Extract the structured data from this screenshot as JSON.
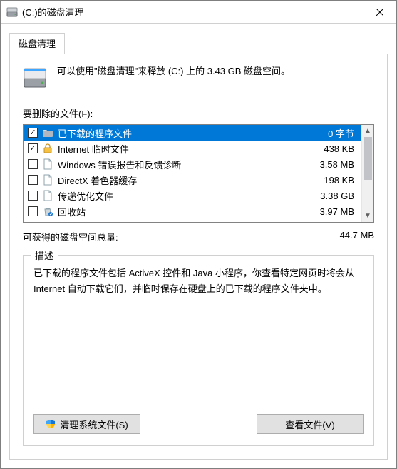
{
  "window": {
    "title": "(C:)的磁盘清理"
  },
  "tab": {
    "label": "磁盘清理"
  },
  "intro": {
    "text": "可以使用\"磁盘清理\"来释放  (C:) 上的 3.43 GB 磁盘空间。"
  },
  "files_section": {
    "label": "要删除的文件(F):",
    "items": [
      {
        "name": "已下载的程序文件",
        "size": "0 字节",
        "checked": true,
        "selected": true,
        "icon": "folder"
      },
      {
        "name": "Internet 临时文件",
        "size": "438 KB",
        "checked": true,
        "selected": false,
        "icon": "lock"
      },
      {
        "name": "Windows 错误报告和反馈诊断",
        "size": "3.58 MB",
        "checked": false,
        "selected": false,
        "icon": "file"
      },
      {
        "name": "DirectX 着色器缓存",
        "size": "198 KB",
        "checked": false,
        "selected": false,
        "icon": "file"
      },
      {
        "name": "传递优化文件",
        "size": "3.38 GB",
        "checked": false,
        "selected": false,
        "icon": "file"
      },
      {
        "name": "回收站",
        "size": "3.97 MB",
        "checked": false,
        "selected": false,
        "icon": "recycle"
      }
    ]
  },
  "total": {
    "label": "可获得的磁盘空间总量:",
    "value": "44.7 MB"
  },
  "description": {
    "caption": "描述",
    "text": "已下载的程序文件包括 ActiveX 控件和 Java 小程序，你查看特定网页时将会从 Internet 自动下载它们，并临时保存在硬盘上的已下载的程序文件夹中。"
  },
  "buttons": {
    "clean_system": "清理系统文件(S)",
    "view_files": "查看文件(V)"
  }
}
